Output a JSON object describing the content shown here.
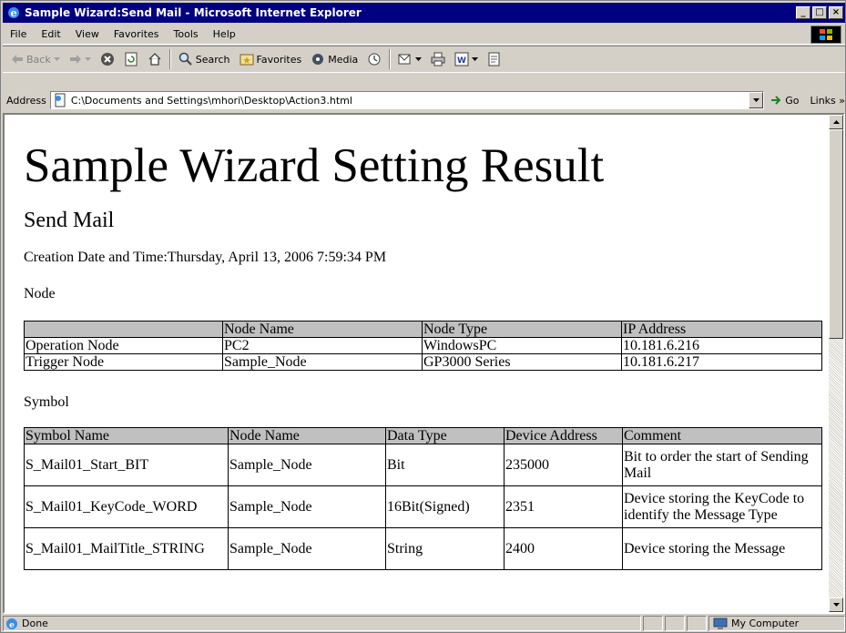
{
  "window": {
    "title": "Sample Wizard:Send Mail - Microsoft Internet Explorer",
    "buttons": {
      "minimize": "_",
      "maximize": "□",
      "close": "×"
    }
  },
  "menu": [
    "File",
    "Edit",
    "View",
    "Favorites",
    "Tools",
    "Help"
  ],
  "toolbar": {
    "back": "Back",
    "search": "Search",
    "favorites": "Favorites",
    "media": "Media"
  },
  "address": {
    "label": "Address",
    "value": "C:\\Documents and Settings\\mhori\\Desktop\\Action3.html",
    "go": "Go",
    "links": "Links »"
  },
  "page": {
    "heading": "Sample Wizard Setting Result",
    "subheading": "Send Mail",
    "creation": "Creation Date and Time:Thursday, April 13, 2006 7:59:34 PM",
    "node_label": "Node",
    "node_table": {
      "headers": [
        "",
        "Node Name",
        "Node Type",
        "IP Address"
      ],
      "rows": [
        [
          "Operation Node",
          "PC2",
          "WindowsPC",
          "10.181.6.216"
        ],
        [
          "Trigger Node",
          "Sample_Node",
          "GP3000 Series",
          "10.181.6.217"
        ]
      ]
    },
    "symbol_label": "Symbol",
    "symbol_table": {
      "headers": [
        "Symbol Name",
        "Node Name",
        "Data Type",
        "Device Address",
        "Comment"
      ],
      "rows": [
        [
          "S_Mail01_Start_BIT",
          "Sample_Node",
          "Bit",
          "235000",
          "Bit to order the start of Sending Mail"
        ],
        [
          "S_Mail01_KeyCode_WORD",
          "Sample_Node",
          "16Bit(Signed)",
          "2351",
          "Device storing the KeyCode to identify the Message Type"
        ],
        [
          "S_Mail01_MailTitle_STRING",
          "Sample_Node",
          "String",
          "2400",
          "Device storing the Message"
        ]
      ]
    }
  },
  "status": {
    "text": "Done",
    "zone": "My Computer"
  }
}
